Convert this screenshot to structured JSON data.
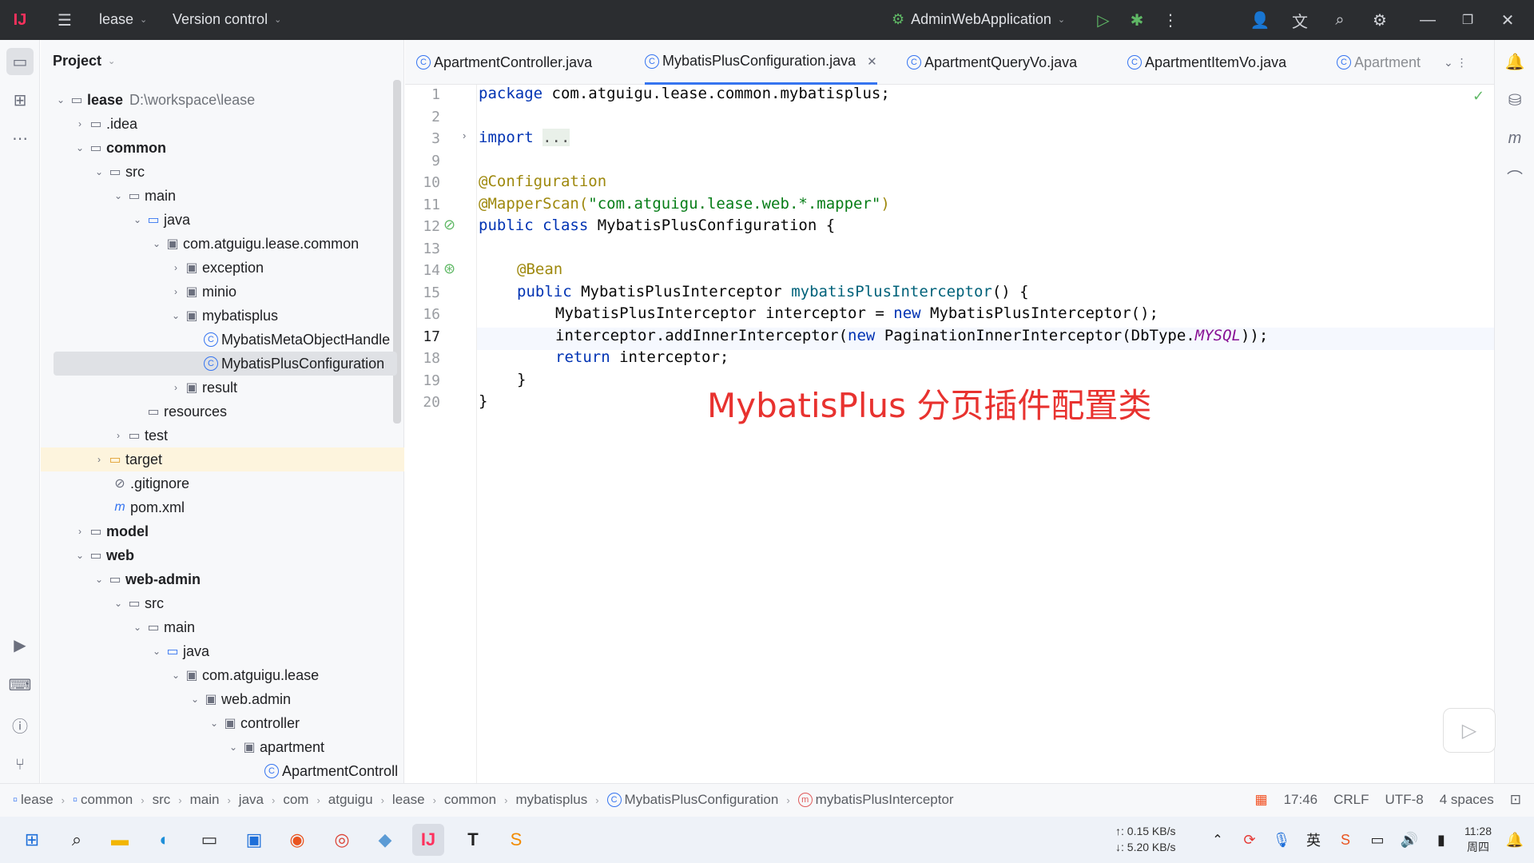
{
  "titlebar": {
    "project": "lease",
    "vcs": "Version control",
    "run_config": "AdminWebApplication"
  },
  "project_panel": {
    "title": "Project",
    "root_name": "lease",
    "root_path": "D:\\workspace\\lease",
    "items": [
      {
        "label": "lease",
        "depth": 0
      },
      {
        "label": ".idea",
        "depth": 1
      },
      {
        "label": "common",
        "depth": 1
      },
      {
        "label": "src",
        "depth": 2
      },
      {
        "label": "main",
        "depth": 3
      },
      {
        "label": "java",
        "depth": 4
      },
      {
        "label": "com.atguigu.lease.common",
        "depth": 5
      },
      {
        "label": "exception",
        "depth": 6
      },
      {
        "label": "minio",
        "depth": 6
      },
      {
        "label": "mybatisplus",
        "depth": 6
      },
      {
        "label": "MybatisMetaObjectHandle",
        "depth": 7
      },
      {
        "label": "MybatisPlusConfiguration",
        "depth": 7
      },
      {
        "label": "result",
        "depth": 6
      },
      {
        "label": "resources",
        "depth": 4
      },
      {
        "label": "test",
        "depth": 3
      },
      {
        "label": "target",
        "depth": 2
      },
      {
        "label": ".gitignore",
        "depth": 2
      },
      {
        "label": "pom.xml",
        "depth": 2
      },
      {
        "label": "model",
        "depth": 1
      },
      {
        "label": "web",
        "depth": 1
      },
      {
        "label": "web-admin",
        "depth": 2
      },
      {
        "label": "src",
        "depth": 3
      },
      {
        "label": "main",
        "depth": 4
      },
      {
        "label": "java",
        "depth": 5
      },
      {
        "label": "com.atguigu.lease",
        "depth": 6
      },
      {
        "label": "web.admin",
        "depth": 7
      },
      {
        "label": "controller",
        "depth": 8
      },
      {
        "label": "apartment",
        "depth": 9
      },
      {
        "label": "ApartmentControll",
        "depth": 10
      }
    ]
  },
  "tabs": [
    {
      "label": "ApartmentController.java"
    },
    {
      "label": "MybatisPlusConfiguration.java"
    },
    {
      "label": "ApartmentQueryVo.java"
    },
    {
      "label": "ApartmentItemVo.java"
    },
    {
      "label": "Apartment"
    }
  ],
  "editor": {
    "line_numbers": [
      "1",
      "2",
      "3",
      "9",
      "10",
      "11",
      "12",
      "13",
      "14",
      "15",
      "16",
      "17",
      "18",
      "19",
      "20"
    ],
    "caption": "MybatisPlus 分页插件配置类"
  },
  "code": {
    "l1_kw": "package",
    "l1_rest": " com.atguigu.lease.common.mybatisplus;",
    "l3_kw": "import",
    "l3_fold": "...",
    "l10": "@Configuration",
    "l11_ann": "@MapperScan(",
    "l11_str": "\"com.atguigu.lease.web.*.mapper\"",
    "l11_end": ")",
    "l12_kw": "public class",
    "l12_rest": " MybatisPlusConfiguration {",
    "l14": "@Bean",
    "l15_kw": "public",
    "l15_type": " MybatisPlusInterceptor ",
    "l15_fn": "mybatisPlusInterceptor",
    "l15_end": "() {",
    "l16_a": "MybatisPlusInterceptor interceptor = ",
    "l16_kw": "new",
    "l16_b": " MybatisPlusInterceptor();",
    "l17_a": "interceptor.addInnerInterceptor(",
    "l17_kw": "new",
    "l17_b": " PaginationInnerInterceptor(DbType.",
    "l17_it": "MYSQL",
    "l17_end": "));",
    "l18_kw": "return",
    "l18_rest": " interceptor;",
    "l19": "}",
    "l20": "}"
  },
  "statusbar": {
    "breadcrumbs": [
      "lease",
      "common",
      "src",
      "main",
      "java",
      "com",
      "atguigu",
      "lease",
      "common",
      "mybatisplus",
      "MybatisPlusConfiguration",
      "mybatisPlusInterceptor"
    ],
    "position": "17:46",
    "line_sep": "CRLF",
    "encoding": "UTF-8",
    "indent": "4 spaces"
  },
  "taskbar": {
    "net_up": "↑: 0.15 KB/s",
    "net_down": "↓: 5.20 KB/s",
    "time": "11:28",
    "day": "周四"
  },
  "colors": {
    "accent": "#3574f0",
    "caption": "#e8322f",
    "titlebar": "#2b2d30"
  }
}
